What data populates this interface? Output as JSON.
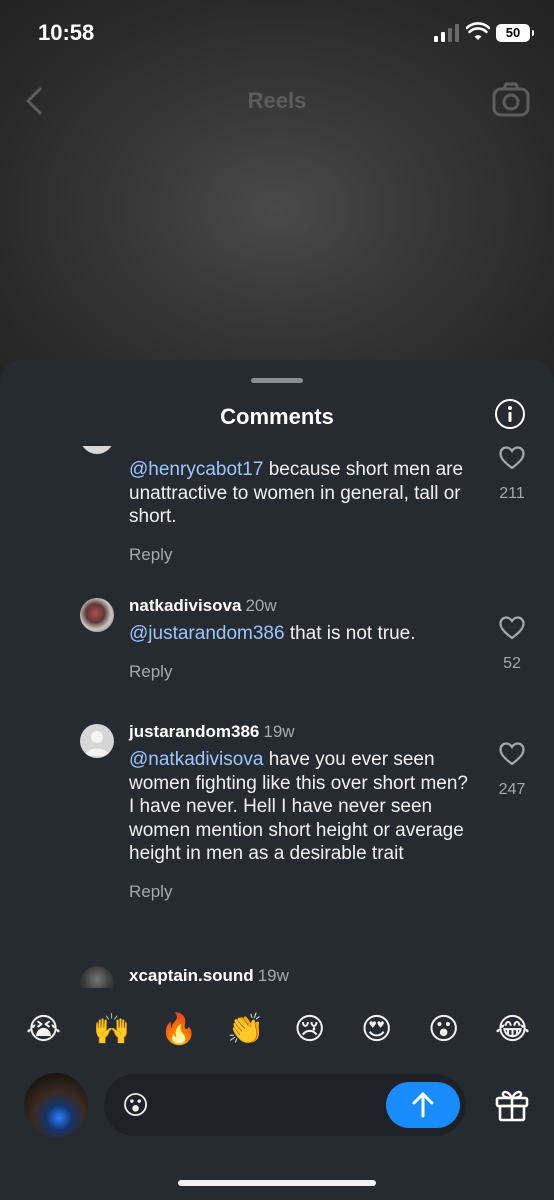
{
  "status_bar": {
    "time": "10:58",
    "battery": "50"
  },
  "header": {
    "title": "Reels",
    "back_icon": "chevron-left-icon",
    "camera_icon": "camera-icon"
  },
  "sheet": {
    "title": "Comments",
    "info_icon": "info-icon"
  },
  "comments": [
    {
      "username": "",
      "age": "",
      "mention": "@henrycabot17",
      "text": " because short men are unattractive to women in general, tall or short.",
      "reply": "Reply",
      "likes": "211"
    },
    {
      "username": "natkadivisova",
      "age": "20w",
      "mention": "@justarandom386",
      "text": " that is not true.",
      "reply": "Reply",
      "likes": "52"
    },
    {
      "username": "justarandom386",
      "age": "19w",
      "mention": "@natkadivisova",
      "text": " have you ever seen women fighting like this over short men? I have never. Hell I have never seen women mention short height or average height in men as a desirable trait",
      "reply": "Reply",
      "likes": "247"
    },
    {
      "username": "xcaptain.sound",
      "age": "19w"
    }
  ],
  "emoji_bar": [
    "😭",
    "🙌",
    "🔥",
    "👏",
    "😢",
    "😍",
    "😮",
    "😂"
  ],
  "composer": {
    "emoji": "😮",
    "send_icon": "arrow-up-icon",
    "gift_icon": "gift-icon"
  },
  "colors": {
    "accent": "#1a8cff",
    "mention": "#9cc7ff",
    "sheet_bg": "#262a31"
  }
}
